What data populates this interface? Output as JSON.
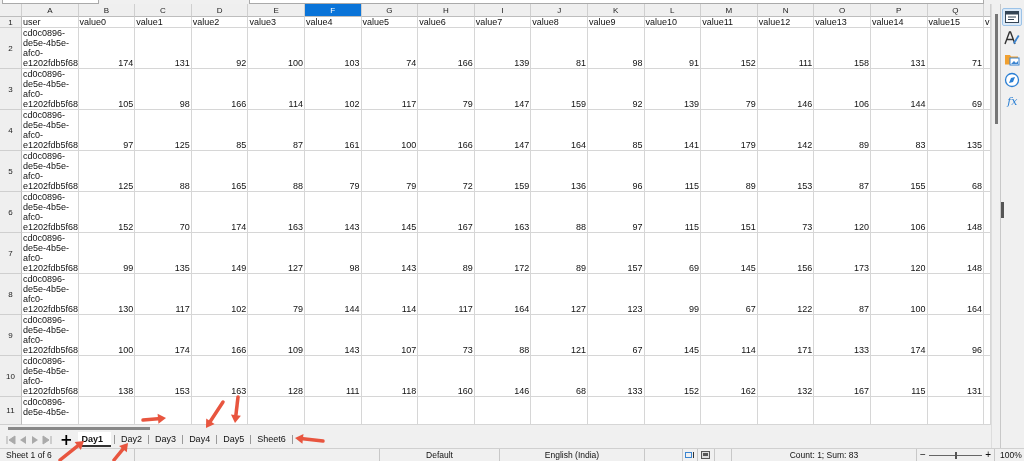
{
  "columns": [
    {
      "label": "A",
      "selected": false
    },
    {
      "label": "B",
      "selected": false
    },
    {
      "label": "C",
      "selected": false
    },
    {
      "label": "D",
      "selected": false
    },
    {
      "label": "E",
      "selected": false
    },
    {
      "label": "F",
      "selected": true
    },
    {
      "label": "G",
      "selected": false
    },
    {
      "label": "H",
      "selected": false
    },
    {
      "label": "I",
      "selected": false
    },
    {
      "label": "J",
      "selected": false
    },
    {
      "label": "K",
      "selected": false
    },
    {
      "label": "L",
      "selected": false
    },
    {
      "label": "M",
      "selected": false
    },
    {
      "label": "N",
      "selected": false
    },
    {
      "label": "O",
      "selected": false
    },
    {
      "label": "P",
      "selected": false
    },
    {
      "label": "Q",
      "selected": false
    }
  ],
  "rows": [
    {
      "number": "1",
      "cells": [
        "user",
        "value0",
        "value1",
        "value2",
        "value3",
        "value4",
        "value5",
        "value6",
        "value7",
        "value8",
        "value9",
        "value10",
        "value11",
        "value12",
        "value13",
        "value14",
        "value15",
        "v"
      ]
    },
    {
      "number": "2",
      "cells": [
        "cd0c0896-de5e-4b5e-afc0-e1202fdb5f68",
        "174",
        "131",
        "92",
        "100",
        "103",
        "74",
        "166",
        "139",
        "81",
        "98",
        "91",
        "152",
        "111",
        "158",
        "131",
        "71"
      ]
    },
    {
      "number": "3",
      "cells": [
        "cd0c0896-de5e-4b5e-afc0-e1202fdb5f68",
        "105",
        "98",
        "166",
        "114",
        "102",
        "117",
        "79",
        "147",
        "159",
        "92",
        "139",
        "79",
        "146",
        "106",
        "144",
        "69"
      ]
    },
    {
      "number": "4",
      "cells": [
        "cd0c0896-de5e-4b5e-afc0-e1202fdb5f68",
        "97",
        "125",
        "85",
        "87",
        "161",
        "100",
        "166",
        "147",
        "164",
        "85",
        "141",
        "179",
        "142",
        "89",
        "83",
        "135"
      ]
    },
    {
      "number": "5",
      "cells": [
        "cd0c0896-de5e-4b5e-afc0-e1202fdb5f68",
        "125",
        "88",
        "165",
        "88",
        "79",
        "79",
        "72",
        "159",
        "136",
        "96",
        "115",
        "89",
        "153",
        "87",
        "155",
        "68"
      ]
    },
    {
      "number": "6",
      "cells": [
        "cd0c0896-de5e-4b5e-afc0-e1202fdb5f68",
        "152",
        "70",
        "174",
        "163",
        "143",
        "145",
        "167",
        "163",
        "88",
        "97",
        "115",
        "151",
        "73",
        "120",
        "106",
        "148"
      ]
    },
    {
      "number": "7",
      "cells": [
        "cd0c0896-de5e-4b5e-afc0-e1202fdb5f68",
        "99",
        "135",
        "149",
        "127",
        "98",
        "143",
        "89",
        "172",
        "89",
        "157",
        "69",
        "145",
        "156",
        "173",
        "120",
        "148"
      ]
    },
    {
      "number": "8",
      "cells": [
        "cd0c0896-de5e-4b5e-afc0-e1202fdb5f68",
        "130",
        "117",
        "102",
        "79",
        "144",
        "114",
        "117",
        "164",
        "127",
        "123",
        "99",
        "67",
        "122",
        "87",
        "100",
        "164"
      ]
    },
    {
      "number": "9",
      "cells": [
        "cd0c0896-de5e-4b5e-afc0-e1202fdb5f68",
        "100",
        "174",
        "166",
        "109",
        "143",
        "107",
        "73",
        "88",
        "121",
        "67",
        "145",
        "114",
        "171",
        "133",
        "174",
        "96"
      ]
    },
    {
      "number": "10",
      "cells": [
        "cd0c0896-de5e-4b5e-afc0-e1202fdb5f68",
        "138",
        "153",
        "163",
        "128",
        "111",
        "118",
        "160",
        "146",
        "68",
        "133",
        "152",
        "162",
        "132",
        "167",
        "115",
        "131"
      ]
    },
    {
      "number": "11",
      "cells": [
        "cd0c0896-de5e-4b5e-"
      ]
    }
  ],
  "add_sheet_button": "+",
  "sheet_tabs": [
    {
      "label": "Day1",
      "selected": true
    },
    {
      "label": "Day2",
      "selected": false
    },
    {
      "label": "Day3",
      "selected": false
    },
    {
      "label": "Day4",
      "selected": false
    },
    {
      "label": "Day5",
      "selected": false
    },
    {
      "label": "Sheet6",
      "selected": false
    }
  ],
  "sidebar": [
    {
      "kind": "properties",
      "selected": true
    },
    {
      "kind": "styles",
      "selected": false
    },
    {
      "kind": "gallery",
      "selected": false
    },
    {
      "kind": "navigator",
      "selected": false
    },
    {
      "kind": "functions",
      "selected": false,
      "label": "fx"
    }
  ],
  "status_bar": {
    "sheet": "Sheet 1 of 6",
    "page_style": "Default",
    "language": "English (India)",
    "selection": "Count: 1; Sum: 83",
    "zoom_out": "−",
    "zoom_in": "+",
    "zoom": {
      "level": 0.5
    },
    "zoom_percent": "100%"
  }
}
